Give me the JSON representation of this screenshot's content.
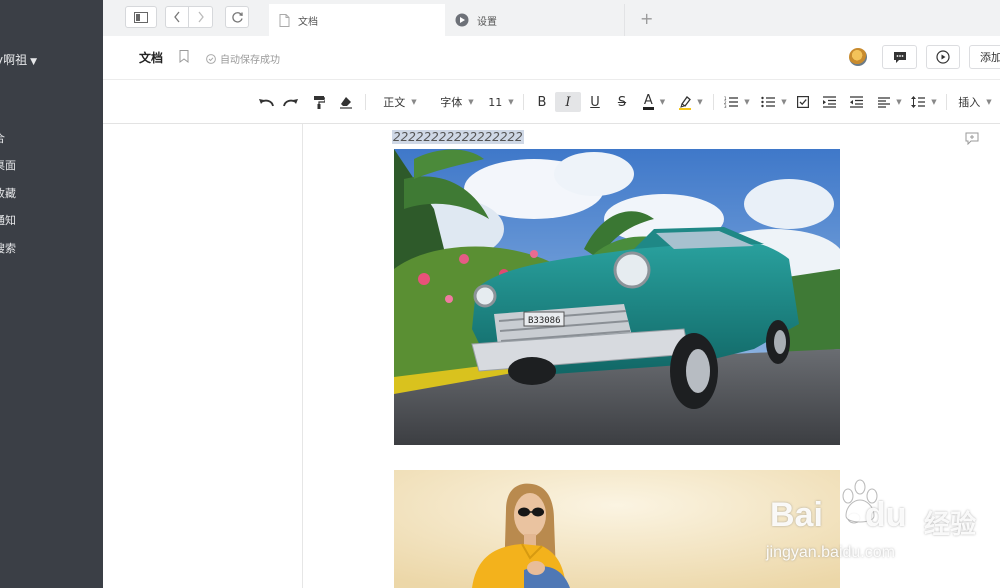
{
  "sidebar": {
    "user_name": "y啊祖",
    "items": [
      {
        "label": "合"
      },
      {
        "label": "桌面"
      },
      {
        "label": "收藏"
      },
      {
        "label": "通知"
      },
      {
        "label": "搜索"
      }
    ]
  },
  "tabs": [
    {
      "label": "文档",
      "icon": "document-icon",
      "active": true
    },
    {
      "label": "设置",
      "icon": "settings-icon",
      "active": false
    }
  ],
  "header": {
    "doc_title": "文档",
    "save_status": "自动保存成功",
    "add_label": "添加"
  },
  "toolbar": {
    "paragraph_style": "正文",
    "font_family": "字体",
    "font_size": "11",
    "bold": "B",
    "italic": "I",
    "underline": "U",
    "strikethrough": "S",
    "font_color": "A",
    "insert_label": "插入",
    "font_color_hex": "#222222",
    "highlight_hex": "#f5c518"
  },
  "document": {
    "selected_text": "22222222222222222"
  },
  "watermark": {
    "brand": "Bai",
    "brand2": "du",
    "product": "经验",
    "url": "jingyan.baidu.com"
  }
}
